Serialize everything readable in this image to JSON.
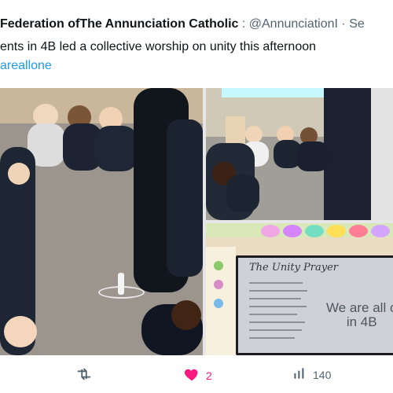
{
  "tweet": {
    "author": "Federation ofThe Annunciation Catholic",
    "handle_separator": ":",
    "handle": "@AnnunciationI · Se",
    "text": "ents in 4B led a collective worship on unity this afternoon",
    "hashtag": "areallone"
  },
  "media": {
    "slide_title": "The Unity Prayer",
    "slide_main_line1": "We are all o",
    "slide_main_line2": "in 4B"
  },
  "actions": {
    "retweet_icon": "retweet-icon",
    "like_icon": "heart-icon",
    "like_count": "2",
    "views_icon": "views-bar-chart-icon",
    "views_count": "140",
    "like_color": "#f91880",
    "link_color": "#1d9bf0",
    "muted_color": "#536471"
  }
}
